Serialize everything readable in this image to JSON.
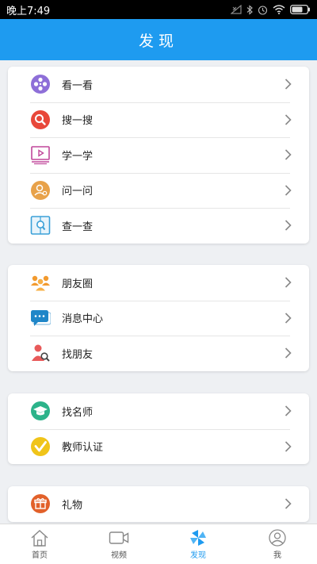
{
  "status_bar": {
    "time": "晚上7:49"
  },
  "header": {
    "title": "发现"
  },
  "sections": [
    {
      "items": [
        {
          "label": "看一看",
          "icon": "film-reel-icon",
          "color": "#8e6fd8"
        },
        {
          "label": "搜一搜",
          "icon": "search-icon",
          "color": "#e8483a"
        },
        {
          "label": "学一学",
          "icon": "video-lesson-icon",
          "color": "#c0479a"
        },
        {
          "label": "问一问",
          "icon": "user-question-icon",
          "color": "#e8a24a"
        },
        {
          "label": "查一查",
          "icon": "book-search-icon",
          "color": "#3aa0d8"
        }
      ]
    },
    {
      "items": [
        {
          "label": "朋友圈",
          "icon": "group-icon",
          "color": "#f29a2e"
        },
        {
          "label": "消息中心",
          "icon": "chat-bubble-icon",
          "color": "#1f86c8"
        },
        {
          "label": "找朋友",
          "icon": "find-friend-icon",
          "color": "#e85a5a"
        }
      ]
    },
    {
      "items": [
        {
          "label": "找名师",
          "icon": "graduation-cap-icon",
          "color": "#2cb38a"
        },
        {
          "label": "教师认证",
          "icon": "check-badge-icon",
          "color": "#f0c419"
        }
      ]
    },
    {
      "items": [
        {
          "label": "礼物",
          "icon": "gift-icon",
          "color": "#e2612a"
        }
      ]
    }
  ],
  "tabs": [
    {
      "label": "首页",
      "icon": "home-icon",
      "active": false
    },
    {
      "label": "视频",
      "icon": "video-camera-icon",
      "active": false
    },
    {
      "label": "发现",
      "icon": "pinwheel-icon",
      "active": true
    },
    {
      "label": "我",
      "icon": "profile-icon",
      "active": false
    }
  ]
}
